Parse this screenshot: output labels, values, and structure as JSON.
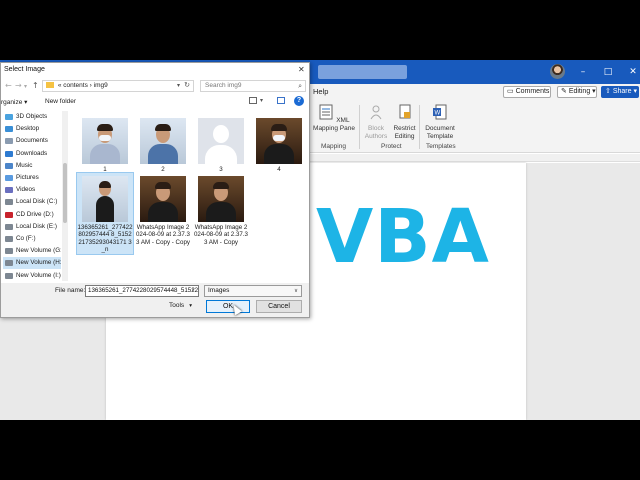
{
  "word": {
    "menu_help": "Help",
    "comments_label": "Comments",
    "editing_label": "Editing",
    "share_label": "Share",
    "window_controls": {
      "minimize": "–",
      "maximize": "□",
      "close": "✕"
    },
    "ribbon": {
      "xml_mapping_pane": "XML Mapping Pane",
      "block_authors": "Block Authors",
      "restrict_editing": "Restrict Editing",
      "document_template": "Document Template",
      "groups": {
        "mapping": "Mapping",
        "protect": "Protect",
        "templates": "Templates"
      }
    },
    "document_text": "VBA",
    "document_text_color": "#1db4e6",
    "accent_color": "#185abd"
  },
  "dialog": {
    "title": "Select Image",
    "close": "✕",
    "breadcrumb": {
      "root_marker": "«",
      "folder1": "contents",
      "separator": "›",
      "folder2": "img9"
    },
    "search_placeholder": "Search img9",
    "toolbar": {
      "organize": "rganize",
      "new_folder": "New folder",
      "help": "?"
    },
    "nav_items": [
      {
        "label": "3D Objects",
        "icon": "cube-icon",
        "color": "#4aa3df"
      },
      {
        "label": "Desktop",
        "icon": "desktop-icon",
        "color": "#3a8fd6"
      },
      {
        "label": "Documents",
        "icon": "document-icon",
        "color": "#8a9bb0"
      },
      {
        "label": "Downloads",
        "icon": "download-icon",
        "color": "#2e7bd1"
      },
      {
        "label": "Music",
        "icon": "music-icon",
        "color": "#4c85c9"
      },
      {
        "label": "Pictures",
        "icon": "pictures-icon",
        "color": "#5a9be0"
      },
      {
        "label": "Videos",
        "icon": "videos-icon",
        "color": "#6a6fbf"
      },
      {
        "label": "Local Disk (C:)",
        "icon": "drive-icon",
        "color": "#7d8792"
      },
      {
        "label": "CD Drive (D:)",
        "icon": "cd-icon",
        "color": "#c8232c"
      },
      {
        "label": "Local Disk (E:)",
        "icon": "drive-icon",
        "color": "#7d8792"
      },
      {
        "label": "Co (F:)",
        "icon": "drive-icon",
        "color": "#7d8792"
      },
      {
        "label": "New Volume (G:",
        "icon": "drive-icon",
        "color": "#7d8792"
      },
      {
        "label": "New Volume (H:",
        "icon": "drive-icon",
        "color": "#7d8792"
      },
      {
        "label": "New Volume (I:)",
        "icon": "drive-icon",
        "color": "#7d8792"
      }
    ],
    "files": [
      {
        "label": "1",
        "thumb": "person-mask-outdoor"
      },
      {
        "label": "2",
        "thumb": "person-portrait"
      },
      {
        "label": "3",
        "thumb": "blank-avatar"
      },
      {
        "label": "4",
        "thumb": "person-mask-dark"
      },
      {
        "label": "136365261_277422802957444 8_515221735293043171 3_n",
        "thumb": "person-standing",
        "selected": true
      },
      {
        "label": "WhatsApp Image 2024-08-09 at 2.37.33 AM - Copy - Copy",
        "thumb": "person-dark-bg"
      },
      {
        "label": "WhatsApp Image 2024-08-09 at 2.37.33 AM - Copy",
        "thumb": "person-dark-bg"
      }
    ],
    "file_name_label": "File name:",
    "file_name_value": "136365261_2774228029574448_515221",
    "file_type_value": "Images",
    "tools_label": "Tools",
    "ok_label": "OK",
    "cancel_label": "Cancel"
  }
}
